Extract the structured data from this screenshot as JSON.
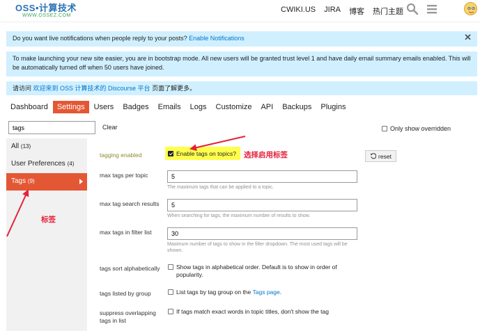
{
  "header": {
    "logo_main": "OSS•计算技术",
    "logo_sub": "WWW.OSSEZ.COM",
    "nav": [
      "CWIKI.US",
      "JIRA",
      "博客",
      "热门主题"
    ]
  },
  "notices": {
    "live_text": "Do you want live notifications when people reply to your posts?",
    "live_link": "Enable Notifications",
    "bootstrap": "To make launching your new site easier, you are in bootstrap mode. All new users will be granted trust level 1 and have daily email summary emails enabled. This will be automatically turned off when 50 users have joined.",
    "welcome_pre": "请访问",
    "welcome_link": "欢迎来到 OSS 计算技术的 Discourse 平台",
    "welcome_post": "页面了解更多。"
  },
  "tabs": [
    "Dashboard",
    "Settings",
    "Users",
    "Badges",
    "Emails",
    "Logs",
    "Customize",
    "API",
    "Backups",
    "Plugins"
  ],
  "filter": {
    "value": "tags",
    "clear": "Clear",
    "only_overridden": "Only show overridden"
  },
  "sidebar": [
    {
      "label": "All",
      "count": "(13)"
    },
    {
      "label": "User Preferences",
      "count": "(4)"
    },
    {
      "label": "Tags",
      "count": "(9)"
    }
  ],
  "settings": {
    "tagging_enabled": {
      "label": "tagging enabled",
      "checkbox": "Enable tags on topics?",
      "reset": "reset"
    },
    "max_tags_per_topic": {
      "label": "max tags per topic",
      "value": "5",
      "help": "The maximum tags that can be applied to a topic."
    },
    "max_tag_search_results": {
      "label": "max tag search results",
      "value": "5",
      "help": "When searching for tags, the maximum number of results to show."
    },
    "max_tags_in_filter_list": {
      "label": "max tags in filter list",
      "value": "30",
      "help": "Maximum number of tags to show in the filter dropdown. The most used tags will be shown."
    },
    "tags_sort_alphabetically": {
      "label": "tags sort alphabetically",
      "checkbox": "Show tags in alphabetical order. Default is to show in order of popularity."
    },
    "tags_listed_by_group": {
      "label": "tags listed by group",
      "checkbox_pre": "List tags by tag group on the",
      "checkbox_link": "Tags page",
      "checkbox_post": "."
    },
    "suppress_overlapping": {
      "label": "suppress overlapping tags in list",
      "checkbox": "If tags match exact words in topic titles, don't show the tag"
    }
  },
  "annotations": {
    "enable_label": "选择启用标签",
    "tags_label": "标签"
  },
  "colors": {
    "accent": "#e45735",
    "notice_bg": "#d1f0ff",
    "highlight": "#ffff4d",
    "annotation": "#e5213a",
    "link": "#0077cc"
  }
}
